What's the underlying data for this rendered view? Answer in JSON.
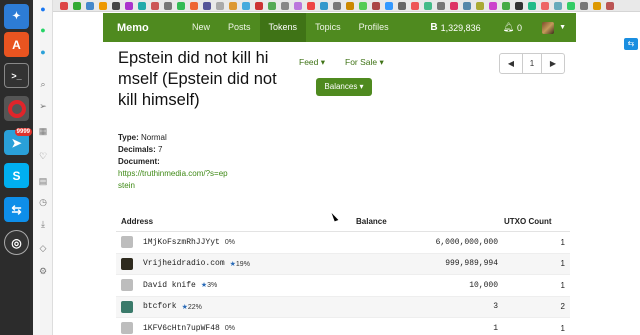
{
  "navbar": {
    "brand": "Memo",
    "links": [
      "New",
      "Posts",
      "Tokens",
      "Topics",
      "Profiles"
    ],
    "active": "Tokens",
    "bch_symbol": "B",
    "balance": "1,329,836",
    "notif_count": "0"
  },
  "token": {
    "name": "Epstein did not kill himself (Epstein did not kill himself)",
    "type_label": "Type:",
    "type_value": "Normal",
    "decimals_label": "Decimals:",
    "decimals_value": "7",
    "document_label": "Document:",
    "document_url": "https://truthinmedia.com/?s=epstein"
  },
  "controls": {
    "feed": "Feed",
    "for_sale": "For Sale",
    "balances": "Balances",
    "page": "1"
  },
  "table": {
    "headers": {
      "address": "Address",
      "balance": "Balance",
      "utxo": "UTXO Count"
    },
    "rows": [
      {
        "name": "1MjKoFszmRhJJYyt",
        "pct": "0%",
        "star": "",
        "balance": "6,000,000,000",
        "utxo": "1",
        "icon_color": "#bdbdbd"
      },
      {
        "name": "Vrijheidradio.com",
        "pct": "19%",
        "star": "★",
        "balance": "999,989,994",
        "utxo": "1",
        "icon_color": "#2e2a1e"
      },
      {
        "name": "David knife",
        "pct": "3%",
        "star": "★",
        "balance": "10,000",
        "utxo": "1",
        "icon_color": "#bdbdbd"
      },
      {
        "name": "btcfork",
        "pct": "22%",
        "star": "★",
        "balance": "3",
        "utxo": "2",
        "icon_color": "#3a7a6a"
      },
      {
        "name": "1KFV6cHtn7upWF48",
        "pct": "0%",
        "star": "",
        "balance": "1",
        "utxo": "1",
        "icon_color": "#bdbdbd"
      }
    ]
  },
  "colors": {
    "brand_green": "#4f8a1f",
    "link_green": "#3f8a16",
    "star_blue": "#2a6bb8"
  }
}
